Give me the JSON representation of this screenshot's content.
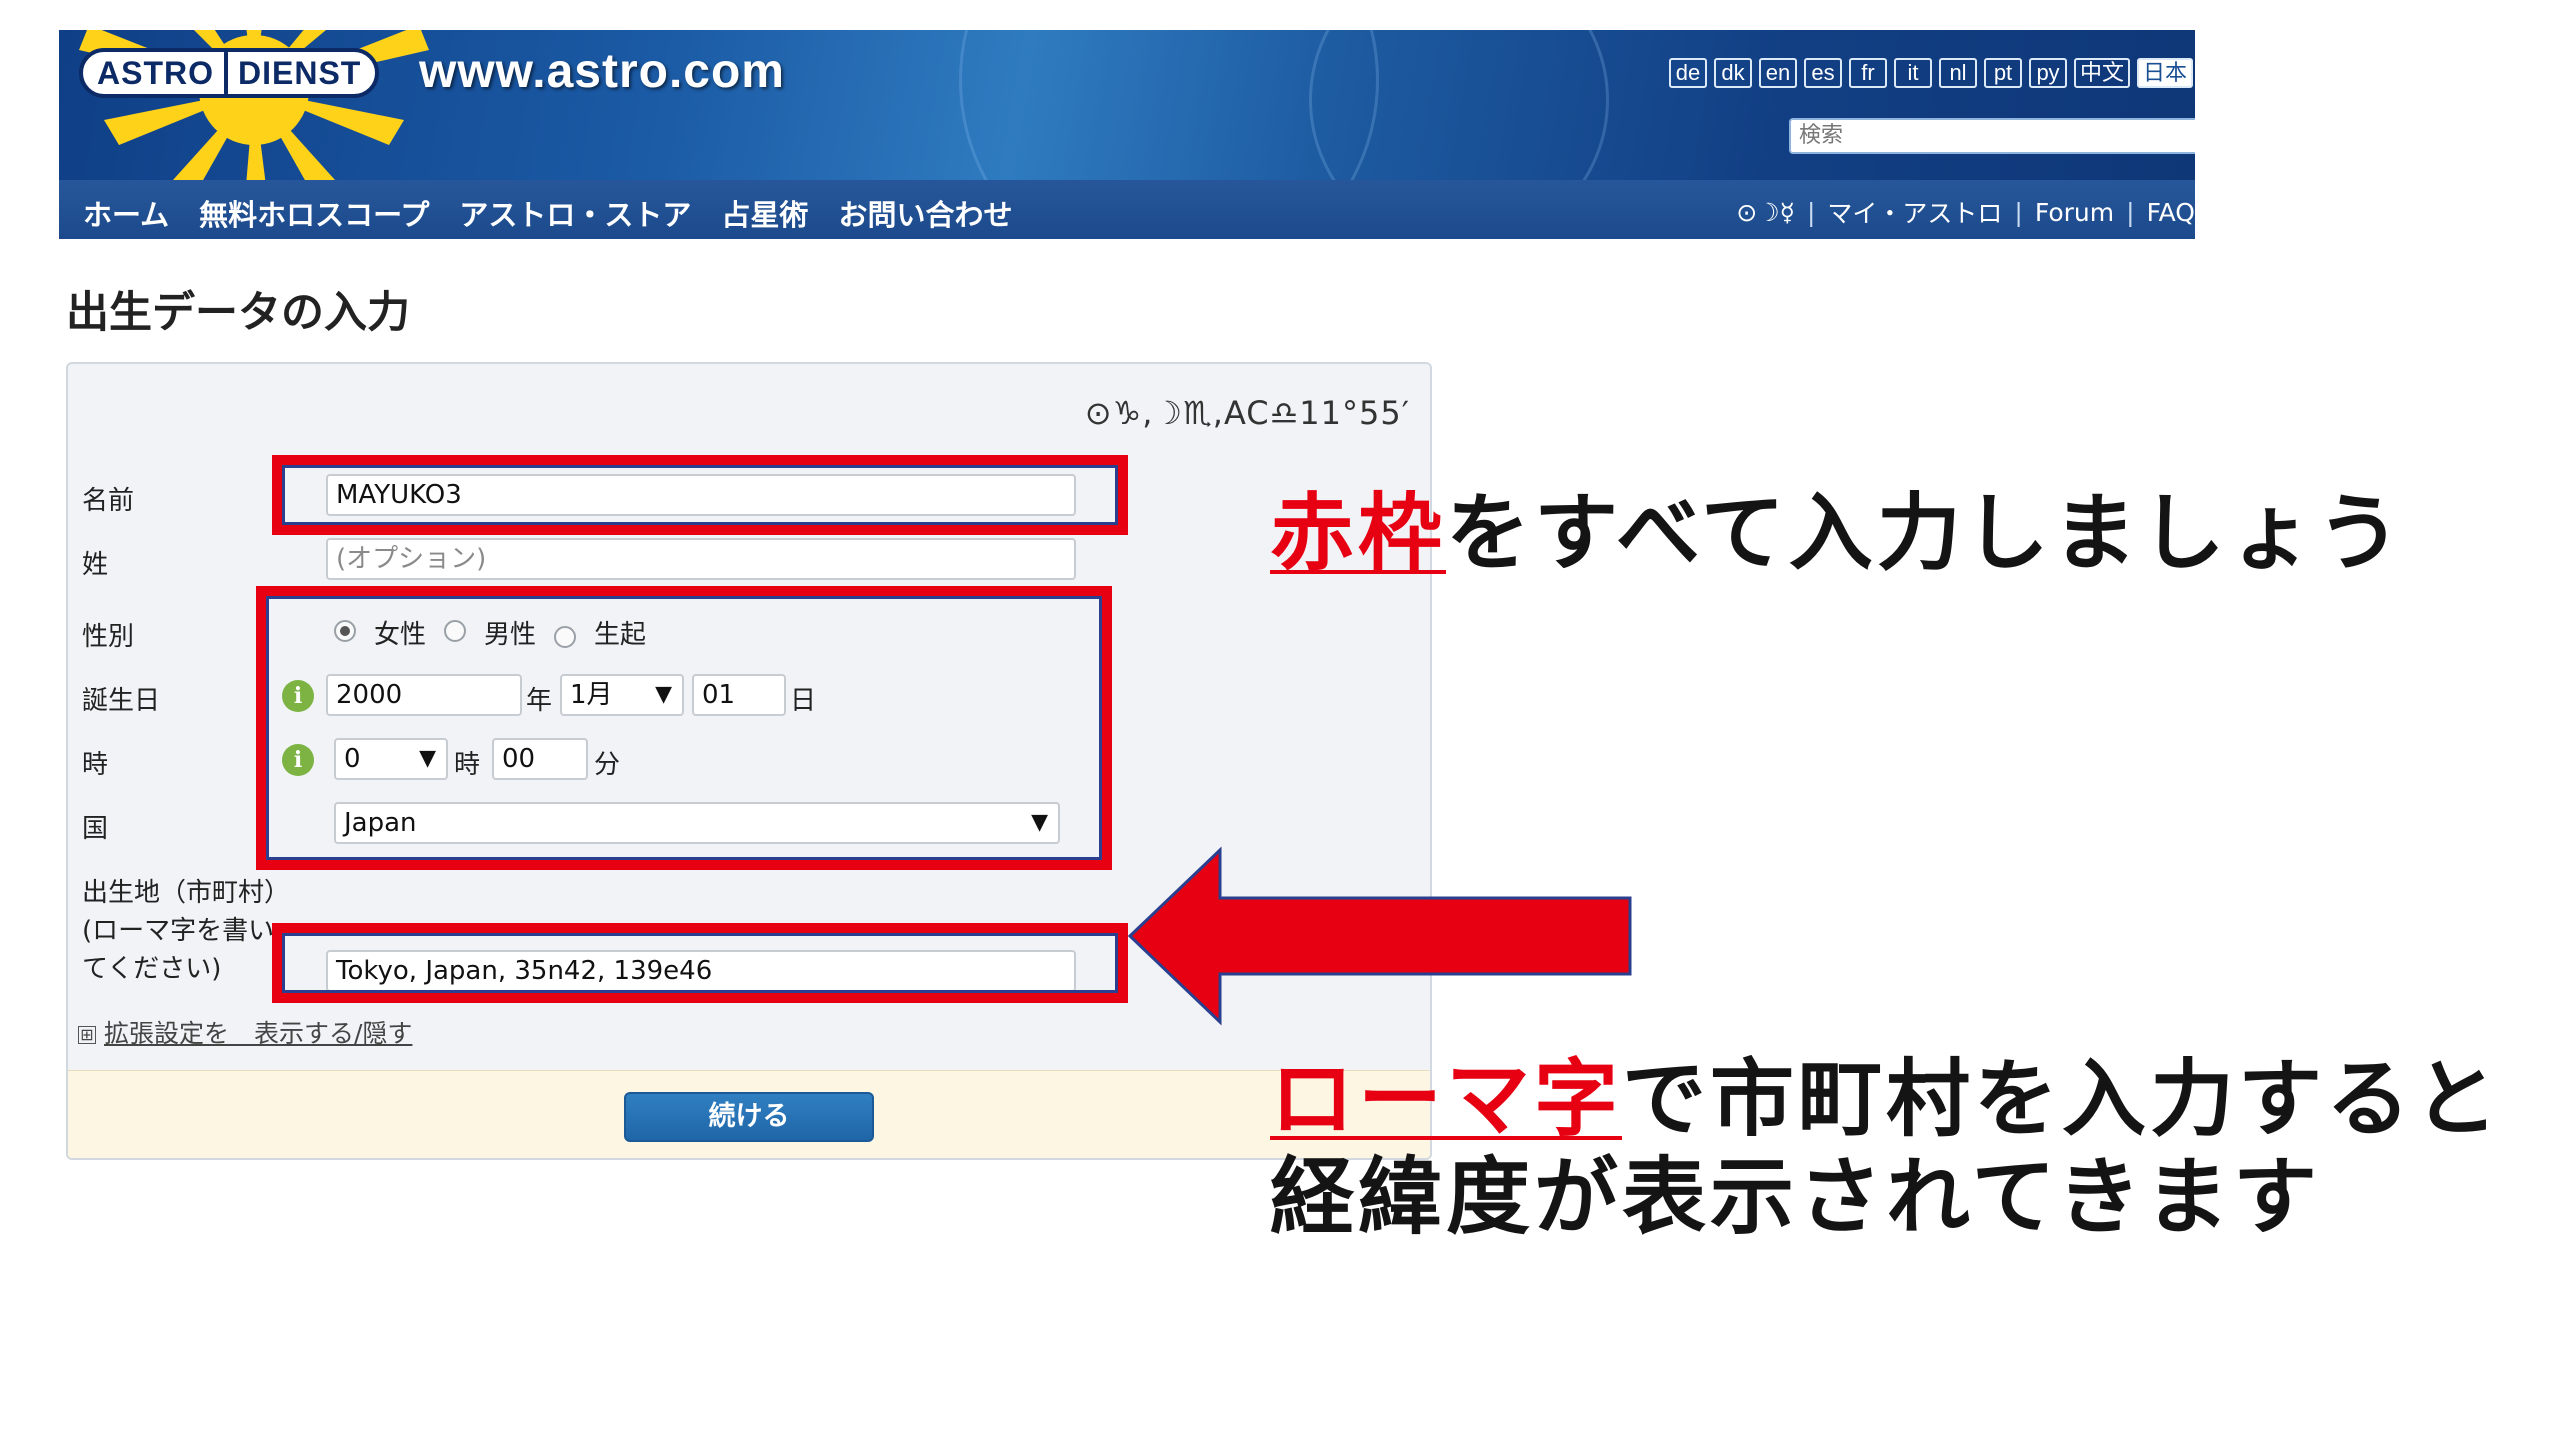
{
  "header": {
    "logo_left": "ASTRO",
    "logo_right": "DIENST",
    "site_url": "www.astro.com",
    "languages": [
      "de",
      "dk",
      "en",
      "es",
      "fr",
      "it",
      "nl",
      "pt",
      "ру",
      "中文",
      "日本"
    ],
    "active_language": "日本",
    "search_placeholder": "検索",
    "nav_left": [
      "ホーム",
      "無料ホロスコープ",
      "アストロ・ストア",
      "占星術",
      "お問い合わせ"
    ],
    "nav_right": [
      "⊙☽☿",
      "マイ・アストロ",
      "Forum",
      "FAQ"
    ]
  },
  "page_title": "出生データの入力",
  "form": {
    "planet_line": "⊙♑,☽♏,AC♎11°55′",
    "name_label": "名前",
    "name_value": "MAYUKO3",
    "surname_label": "姓",
    "surname_placeholder": "(オプション)",
    "gender_label": "性別",
    "gender_options": [
      "女性",
      "男性",
      "生起"
    ],
    "gender_selected": "女性",
    "birthdate_label": "誕生日",
    "year_value": "2000",
    "year_unit": "年",
    "month_value": "1月",
    "day_value": "01",
    "day_unit": "日",
    "time_label": "時",
    "hour_value": "0",
    "hour_unit": "時",
    "minute_value": "00",
    "minute_unit": "分",
    "country_label": "国",
    "country_value": "Japan",
    "birthplace_label": "出生地（市町村）(ローマ字を書いてください)",
    "birthplace_value": "Tokyo, Japan, 35n42, 139e46",
    "extended_toggle": "⊞",
    "extended_link": "拡張設定を　表示する/隠す",
    "continue_button": "続ける"
  },
  "annotations": {
    "note1_highlight": "赤枠",
    "note1_rest": "をすべて入力しましょう",
    "note2_highlight": "ローマ字",
    "note2_rest": "で市町村を入力すると",
    "note2_line2": "経緯度が表示されてきます"
  },
  "colors": {
    "annotation_red": "#e60012",
    "header_blue": "#1b4f93",
    "button_blue": "#1f66a8",
    "info_icon_green": "#7cb342"
  },
  "icons": {
    "info": "info-icon",
    "search": "search-icon",
    "dropdown": "chevron-down-icon",
    "arrow": "left-arrow-icon"
  }
}
